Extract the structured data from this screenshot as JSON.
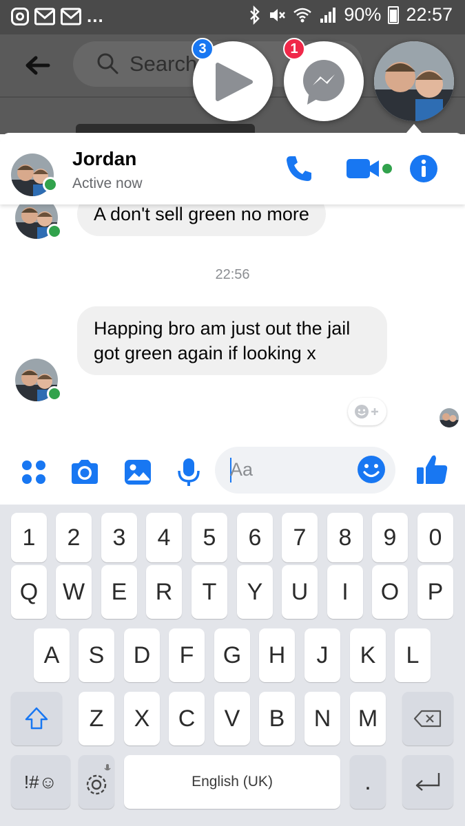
{
  "status_bar": {
    "notification_icons": [
      "instagram-icon",
      "gmail-icon",
      "gmail-icon"
    ],
    "overflow": "...",
    "system_icons": [
      "bluetooth-icon",
      "mute-icon",
      "wifi-icon",
      "signal-icon"
    ],
    "battery": "90%",
    "time": "22:57"
  },
  "background_app": {
    "search_placeholder": "Search"
  },
  "chat_heads": {
    "video_badge": "3",
    "messenger_badge": "1"
  },
  "conversation": {
    "contact_name": "Jordan",
    "contact_status": "Active now",
    "messages": [
      {
        "text": "A don't sell green no more"
      },
      {
        "text": "Happing bro am just out the jail got green again if looking x"
      }
    ],
    "timestamp": "22:56"
  },
  "composer": {
    "placeholder": "Aa"
  },
  "keyboard": {
    "number_row": [
      "1",
      "2",
      "3",
      "4",
      "5",
      "6",
      "7",
      "8",
      "9",
      "0"
    ],
    "row1": [
      "Q",
      "W",
      "E",
      "R",
      "T",
      "Y",
      "U",
      "I",
      "O",
      "P"
    ],
    "row2": [
      "A",
      "S",
      "D",
      "F",
      "G",
      "H",
      "J",
      "K",
      "L"
    ],
    "row3": [
      "Z",
      "X",
      "C",
      "V",
      "B",
      "N",
      "M"
    ],
    "symbols_key": "!#☺",
    "space_label": "English (UK)",
    "period_key": "."
  },
  "colors": {
    "accent": "#1877f2",
    "online": "#31a24c",
    "badge_red": "#f02849",
    "bubble": "#f0f0f0",
    "keyboard_bg": "#e3e5ea"
  }
}
